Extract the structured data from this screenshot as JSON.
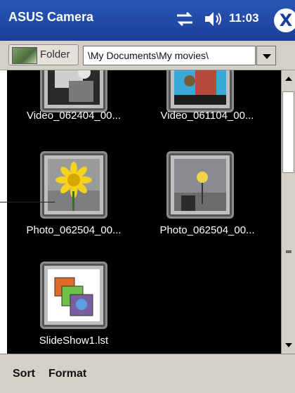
{
  "titlebar": {
    "title": "ASUS Camera",
    "time": "11:03",
    "close_label": "X",
    "icons": [
      "connectivity-icon",
      "speaker-icon"
    ]
  },
  "folderbar": {
    "folder_label": "Folder",
    "path": "\\My Documents\\My movies\\"
  },
  "files": [
    {
      "caption": "Video_062404_00...",
      "type": "video"
    },
    {
      "caption": "Video_061104_00...",
      "type": "video"
    },
    {
      "caption": "Photo_062504_00...",
      "type": "photo"
    },
    {
      "caption": "Photo_062504_00...",
      "type": "photo"
    },
    {
      "caption": "SlideShow1.lst",
      "type": "slideshow"
    }
  ],
  "menubar": {
    "sort_label": "Sort",
    "format_label": "Format"
  },
  "colors": {
    "titlebar": "#1a3f98",
    "chrome": "#d4d0c8",
    "grid_background": "#000000"
  }
}
